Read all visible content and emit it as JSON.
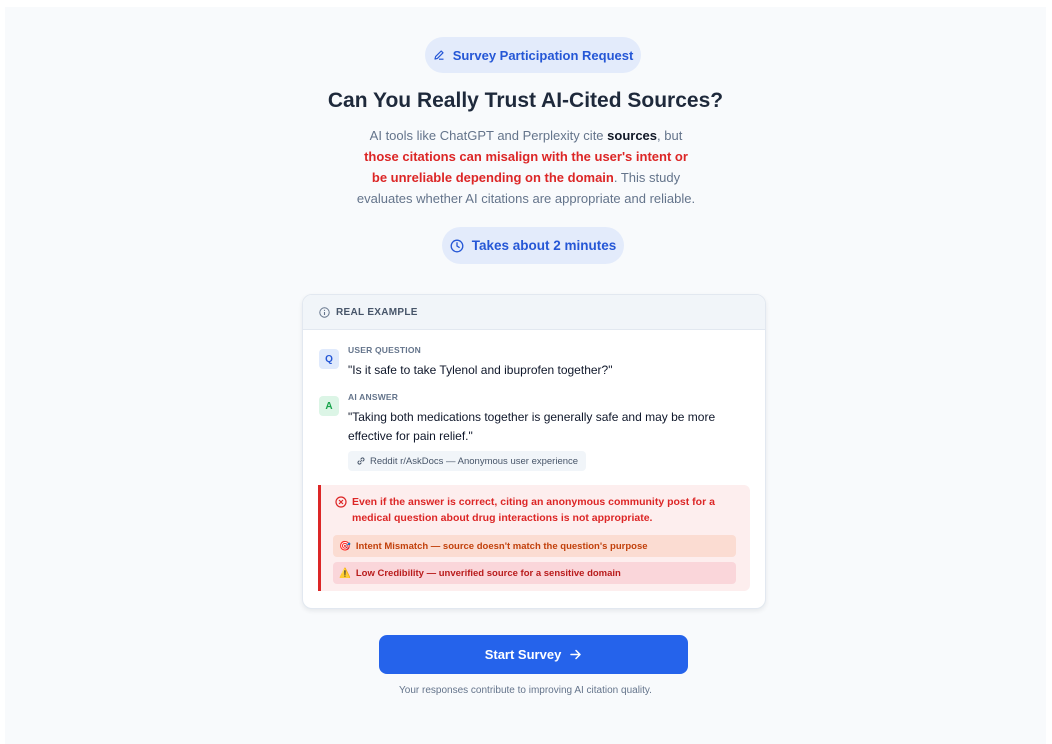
{
  "badge": {
    "icon": "pencil-icon",
    "label": "Survey Participation Request"
  },
  "title": "Can You Really Trust AI-Cited Sources?",
  "intro": {
    "part1": "AI tools like ChatGPT and Perplexity cite ",
    "bold": "sources",
    "part2": ", but ",
    "warning": "those citations can misalign with the user's intent or be unreliable depending on the domain",
    "part3": ". This study evaluates whether AI citations are appropriate and reliable."
  },
  "duration": {
    "icon": "clock-icon",
    "label": "Takes about 2 minutes"
  },
  "example": {
    "header": "REAL EXAMPLE",
    "question": {
      "tag": "Q",
      "label": "USER QUESTION",
      "text": "\"Is it safe to take Tylenol and ibuprofen together?\""
    },
    "answer": {
      "tag": "A",
      "label": "AI ANSWER",
      "text": "\"Taking both medications together is generally safe and may be more effective for pain relief.\""
    },
    "source": {
      "icon": "link-icon",
      "label": "Reddit r/AskDocs — Anonymous user experience"
    },
    "alert": {
      "message": "Even if the answer is correct, citing an anonymous community post for a medical question about drug interactions is not appropriate.",
      "issues": [
        {
          "icon": "target-icon",
          "emoji": "🎯",
          "label": "Intent Mismatch — source doesn't match the question's purpose"
        },
        {
          "icon": "warning-icon",
          "emoji": "⚠️",
          "label": "Low Credibility — unverified source for a sensitive domain"
        }
      ]
    }
  },
  "cta": {
    "label": "Start Survey"
  },
  "footer": "Your responses contribute to improving AI citation quality.",
  "colors": {
    "accent": "#2563eb",
    "danger": "#dc2626",
    "pill_bg": "#e3ebfb"
  }
}
